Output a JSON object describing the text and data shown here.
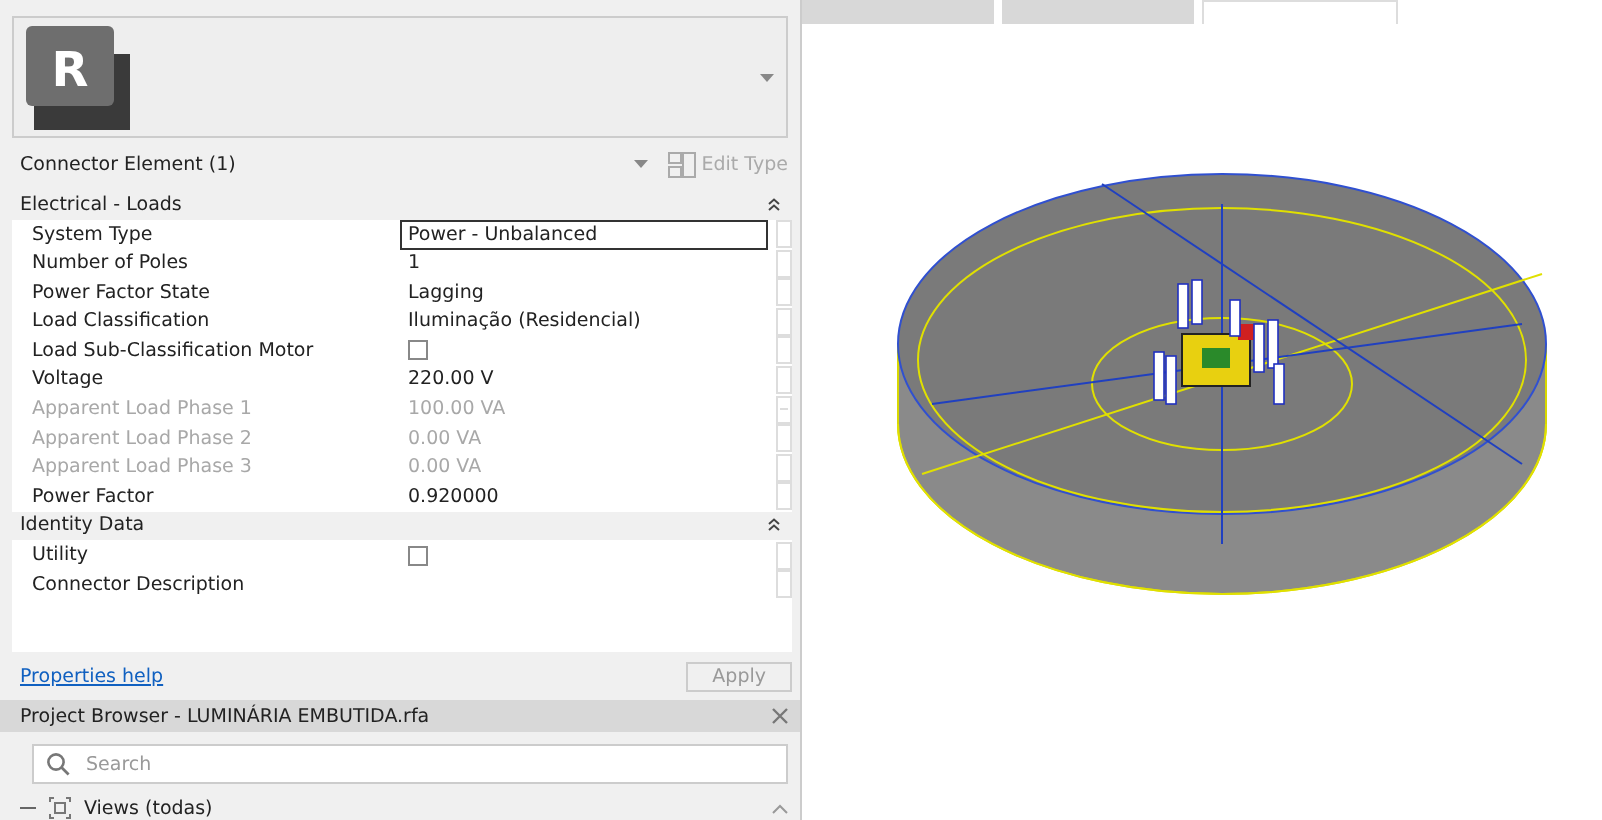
{
  "properties": {
    "logo_letter": "R",
    "type_selector": {
      "label": "Connector Element (1)",
      "edit_type": {
        "label": "Edit Type",
        "disabled": true
      }
    },
    "groups": [
      {
        "name": "Electrical - Loads",
        "expanded": true,
        "rows": [
          {
            "name": "System Type",
            "kind": "text",
            "value": "Power - Unbalanced",
            "disabled": false,
            "editing": true
          },
          {
            "name": "Number of Poles",
            "kind": "text",
            "value": "1",
            "disabled": false,
            "editing": false
          },
          {
            "name": "Power Factor State",
            "kind": "text",
            "value": "Lagging",
            "disabled": false,
            "editing": false
          },
          {
            "name": "Load Classification",
            "kind": "text",
            "value": "Iluminação (Residencial)",
            "disabled": false,
            "editing": false
          },
          {
            "name": "Load Sub-Classification Motor",
            "kind": "checkbox",
            "checked": false,
            "disabled": false,
            "editing": false
          },
          {
            "name": "Voltage",
            "kind": "text",
            "value": "220.00 V",
            "disabled": false,
            "editing": false
          },
          {
            "name": "Apparent Load Phase 1",
            "kind": "text",
            "value": "100.00 VA",
            "disabled": true,
            "editing": false
          },
          {
            "name": "Apparent Load Phase 2",
            "kind": "text",
            "value": "0.00 VA",
            "disabled": true,
            "editing": false
          },
          {
            "name": "Apparent Load Phase 3",
            "kind": "text",
            "value": "0.00 VA",
            "disabled": true,
            "editing": false
          },
          {
            "name": "Power Factor",
            "kind": "text",
            "value": "0.920000",
            "disabled": false,
            "editing": false
          }
        ]
      },
      {
        "name": "Identity Data",
        "expanded": true,
        "rows": [
          {
            "name": "Utility",
            "kind": "checkbox",
            "checked": false,
            "disabled": false,
            "editing": false
          },
          {
            "name": "Connector Description",
            "kind": "empty",
            "disabled": false,
            "editing": false
          }
        ]
      }
    ],
    "help_link": "Properties help",
    "apply": {
      "label": "Apply",
      "disabled": true
    }
  },
  "project_browser": {
    "title": "Project Browser - LUMINÁRIA EMBUTIDA.rfa",
    "search": {
      "placeholder": "Search"
    },
    "tree": [
      {
        "label": "Views (todas)",
        "expanded": true
      }
    ]
  },
  "view_tabs": [
    {
      "selected": false
    },
    {
      "selected": false
    },
    {
      "selected": true
    }
  ]
}
